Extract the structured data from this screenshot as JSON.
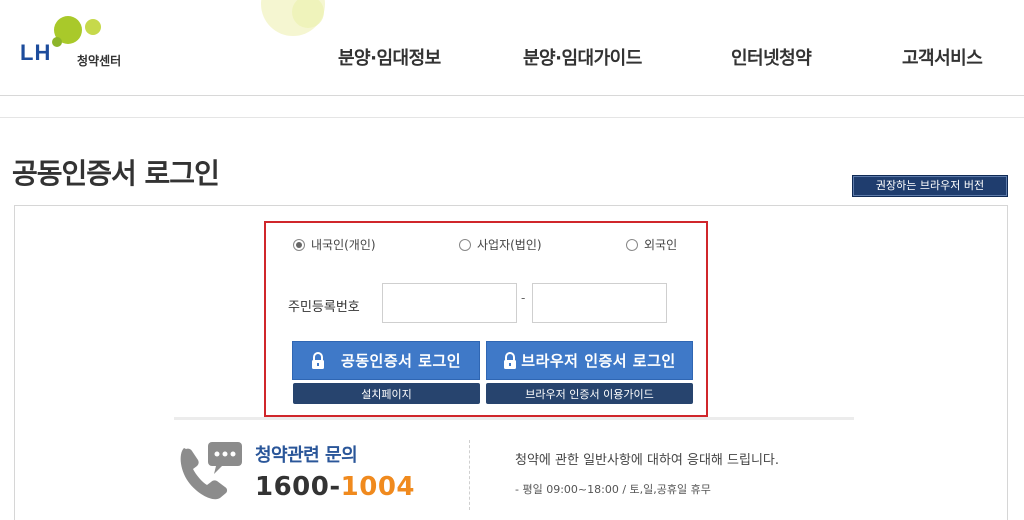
{
  "header": {
    "logo_text": "LH",
    "logo_sub": "청약센터",
    "nav": [
      {
        "label": "분양·임대정보"
      },
      {
        "label": "분양·임대가이드"
      },
      {
        "label": "인터넷청약"
      },
      {
        "label": "고객서비스"
      }
    ]
  },
  "page": {
    "title": "공동인증서 로그인",
    "browser_button": "권장하는 브라우저 버전"
  },
  "login": {
    "user_types": [
      {
        "label": "내국인(개인)",
        "checked": true
      },
      {
        "label": "사업자(법인)",
        "checked": false
      },
      {
        "label": "외국인",
        "checked": false
      }
    ],
    "id_label": "주민등록번호",
    "id_separator": "-",
    "cert_login_button": "공동인증서 로그인",
    "browser_login_button": "브라우저 인증서 로그인",
    "install_page_button": "설치페이지",
    "browser_guide_button": "브라우저 인증서 이용가이드"
  },
  "contact": {
    "title": "청약관련 문의",
    "phone_prefix": "1600-",
    "phone_suffix": "1004",
    "description": "청약에 관한 일반사항에 대하여 응대해 드립니다.",
    "hours": "- 평일 09:00~18:00  /  토,일,공휴일 휴무"
  },
  "colors": {
    "accent_blue": "#3f79c8",
    "navy": "#27446e",
    "highlight_red": "#d0262b",
    "phone_orange": "#f08a1e",
    "logo_green": "#a9c92a"
  }
}
